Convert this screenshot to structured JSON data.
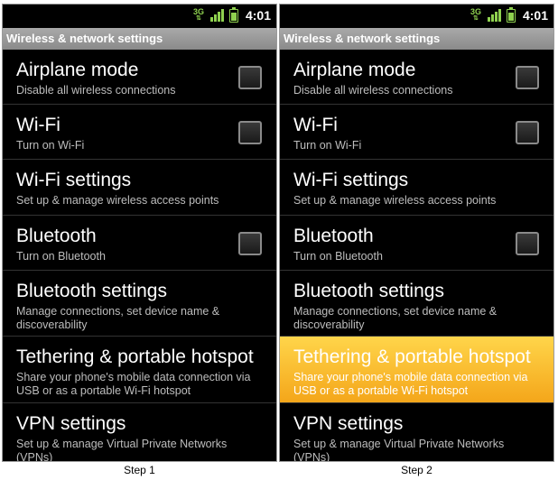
{
  "status_bar": {
    "network": "3G",
    "time": "4:01"
  },
  "screen_title": "Wireless & network settings",
  "items": [
    {
      "title": "Airplane mode",
      "subtitle": "Disable all wireless connections",
      "checkbox": true,
      "checked": false
    },
    {
      "title": "Wi-Fi",
      "subtitle": "Turn on Wi-Fi",
      "checkbox": true,
      "checked": false
    },
    {
      "title": "Wi-Fi settings",
      "subtitle": "Set up & manage wireless access points",
      "checkbox": false
    },
    {
      "title": "Bluetooth",
      "subtitle": "Turn on Bluetooth",
      "checkbox": true,
      "checked": false
    },
    {
      "title": "Bluetooth settings",
      "subtitle": "Manage connections, set device name & discoverability",
      "checkbox": false
    },
    {
      "title": "Tethering & portable hotspot",
      "subtitle": "Share your phone's mobile data connection via USB or as a portable Wi-Fi hotspot",
      "checkbox": false
    },
    {
      "title": "VPN settings",
      "subtitle": "Set up & manage Virtual Private Networks (VPNs)",
      "checkbox": false
    }
  ],
  "captions": {
    "step1": "Step 1",
    "step2": "Step 2"
  },
  "highlight_color": "#f9b92c"
}
